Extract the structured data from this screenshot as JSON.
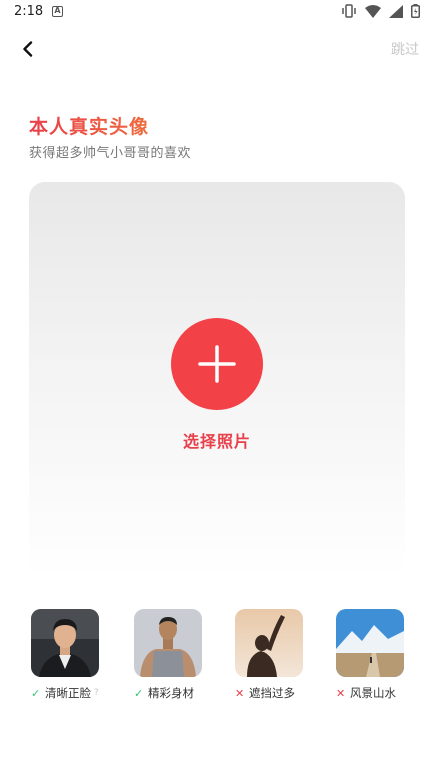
{
  "status_bar": {
    "time": "2:18",
    "left_icon": "A"
  },
  "header": {
    "back_icon": "chevron-left-icon",
    "skip_label": "跳过"
  },
  "intro": {
    "title": "本人真实头像",
    "subtitle": "获得超多帅气小哥哥的喜欢"
  },
  "upload": {
    "button_icon": "plus-icon",
    "label": "选择照片",
    "accent": "#f24147"
  },
  "examples": [
    {
      "caption": "清晰正脸",
      "valid": true,
      "extra": "?"
    },
    {
      "caption": "精彩身材",
      "valid": true,
      "extra": ""
    },
    {
      "caption": "遮挡过多",
      "valid": false,
      "extra": ""
    },
    {
      "caption": "风景山水",
      "valid": false,
      "extra": ""
    }
  ],
  "colors": {
    "title_start": "#e8404a",
    "title_end": "#ef6a3c",
    "ok": "#37c275",
    "bad": "#e8404a",
    "skip": "#c8c8c8"
  }
}
